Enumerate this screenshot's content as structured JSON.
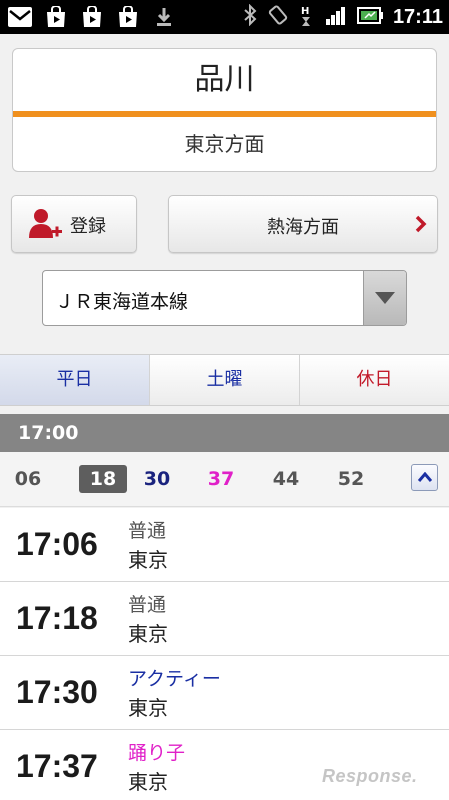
{
  "status_bar": {
    "time": "17:11",
    "left_icons": [
      "mail-icon",
      "play-store-icon",
      "play-store-icon",
      "play-store-icon",
      "download-icon"
    ],
    "right_icons": [
      "bluetooth-icon",
      "rotate-icon",
      "hsdpa-icon",
      "signal-icon",
      "battery-icon"
    ]
  },
  "station": {
    "name": "品川",
    "direction": "東京方面",
    "accent_color": "#f0901e"
  },
  "actions": {
    "register_label": "登録",
    "register_icon": "add-user-icon",
    "other_direction_label": "熱海方面",
    "other_direction_icon": "chevron-right-icon"
  },
  "line_select": {
    "value": "ＪＲ東海道本線"
  },
  "tabs": [
    {
      "label": "平日",
      "active": true
    },
    {
      "label": "土曜",
      "active": false
    },
    {
      "label": "休日",
      "active": false
    }
  ],
  "hour": {
    "label": "17:00"
  },
  "minutes": [
    {
      "label": "06",
      "color": "#555555",
      "selected": false
    },
    {
      "label": "18",
      "color": "#ffffff",
      "selected": true
    },
    {
      "label": "30",
      "color": "#1a237e",
      "selected": false
    },
    {
      "label": "37",
      "color": "#e020c8",
      "selected": false
    },
    {
      "label": "44",
      "color": "#555555",
      "selected": false
    },
    {
      "label": "52",
      "color": "#555555",
      "selected": false
    }
  ],
  "trains": [
    {
      "time": "17:06",
      "type": "普通",
      "type_color": "#555555",
      "destination": "東京"
    },
    {
      "time": "17:18",
      "type": "普通",
      "type_color": "#555555",
      "destination": "東京"
    },
    {
      "time": "17:30",
      "type": "アクティー",
      "type_color": "#1a2fa3",
      "destination": "東京"
    },
    {
      "time": "17:37",
      "type": "踊り子",
      "type_color": "#e020c8",
      "destination": "東京"
    }
  ],
  "watermark": "Response."
}
